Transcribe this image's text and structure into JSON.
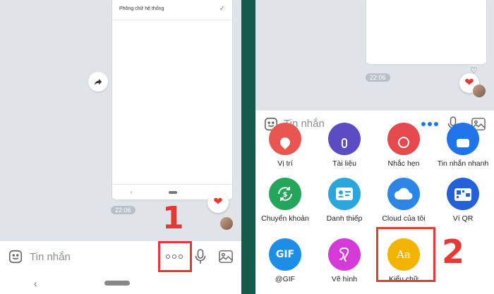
{
  "left": {
    "card_row_text": "Phông chữ hệ thống",
    "card_nav_back": "‹",
    "time": "22:06",
    "input_placeholder": "Tin nhắn",
    "nav_back": "‹",
    "step_label": "1"
  },
  "right": {
    "time": "22:06",
    "input_placeholder": "Tin nhắn",
    "step_label": "2",
    "grid": [
      {
        "label": "Vị trí",
        "icon": "location-icon",
        "color": "#e8564f"
      },
      {
        "label": "Tài liệu",
        "icon": "paperclip-icon",
        "color": "#5b4cc4"
      },
      {
        "label": "Nhắc hẹn",
        "icon": "clock-icon",
        "color": "#e5484d"
      },
      {
        "label": "Tin nhắn nhanh",
        "icon": "quick-message-icon",
        "color": "#1e74e8"
      },
      {
        "label": "Chuyển khoản",
        "icon": "money-transfer-icon",
        "color": "#23a55a"
      },
      {
        "label": "Danh thiếp",
        "icon": "business-card-icon",
        "color": "#2aa6dd"
      },
      {
        "label": "Cloud của tôi",
        "icon": "cloud-icon",
        "color": "#2c86e6"
      },
      {
        "label": "Ví QR",
        "icon": "qr-wallet-icon",
        "color": "#2460d8"
      },
      {
        "label": "@GIF",
        "icon": "gif-icon",
        "color": "#1d8ee8"
      },
      {
        "label": "Vẽ hình",
        "icon": "draw-icon",
        "color": "#d63ad6"
      },
      {
        "label": "Kiểu chữ",
        "icon": "font-style-icon",
        "color": "#f3b400",
        "inner": "Aa"
      }
    ]
  },
  "colors": {
    "accent": "#1e74e8",
    "highlight": "#e53935",
    "divider": "#135a4b"
  }
}
